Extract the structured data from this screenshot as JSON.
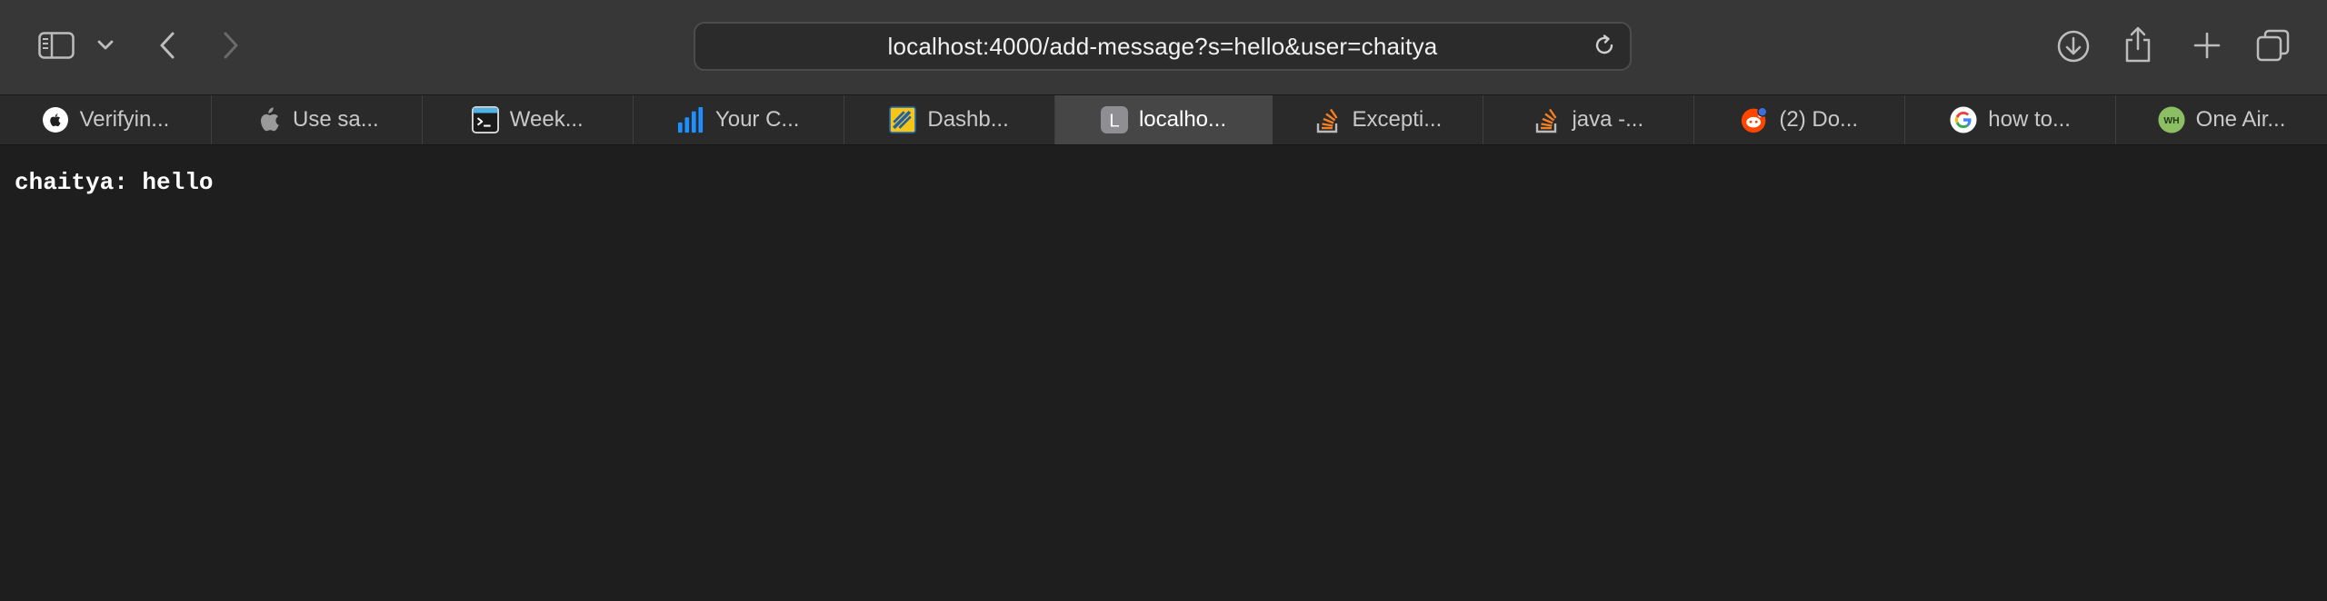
{
  "toolbar": {
    "url": "localhost:4000/add-message?s=hello&user=chaitya",
    "icons": [
      "sidebar-icon",
      "chevron-down-icon",
      "back-icon",
      "forward-icon",
      "reload-icon",
      "download-icon",
      "share-icon",
      "plus-icon",
      "tabs-overview-icon"
    ]
  },
  "tabs": [
    {
      "label": "Verifyin...",
      "icon": "apple-icon"
    },
    {
      "label": "Use sa...",
      "icon": "apple-icon"
    },
    {
      "label": "Week...",
      "icon": "terminal-icon"
    },
    {
      "label": "Your C...",
      "icon": "bar-chart-icon"
    },
    {
      "label": "Dashb...",
      "icon": "dashboard-icon"
    },
    {
      "label": "localho...",
      "icon": "letter-l-icon",
      "letter": "L",
      "active": true
    },
    {
      "label": "Excepti...",
      "icon": "stackoverflow-icon"
    },
    {
      "label": "java -...",
      "icon": "stackoverflow-icon"
    },
    {
      "label": "(2) Do...",
      "icon": "reddit-icon"
    },
    {
      "label": "how to...",
      "icon": "google-icon"
    },
    {
      "label": "One Air...",
      "icon": "wh-icon",
      "letter": "WH"
    }
  ],
  "content": {
    "message": "chaitya: hello"
  },
  "colors": {
    "toolbar_bg": "#373737",
    "tabbar_bg": "#2a2a2a",
    "active_tab_bg": "#464646",
    "page_bg": "#1e1e1e",
    "stackoverflow_orange": "#f48024",
    "reddit_orange": "#ff4500",
    "chart_blue": "#1f8fff"
  }
}
